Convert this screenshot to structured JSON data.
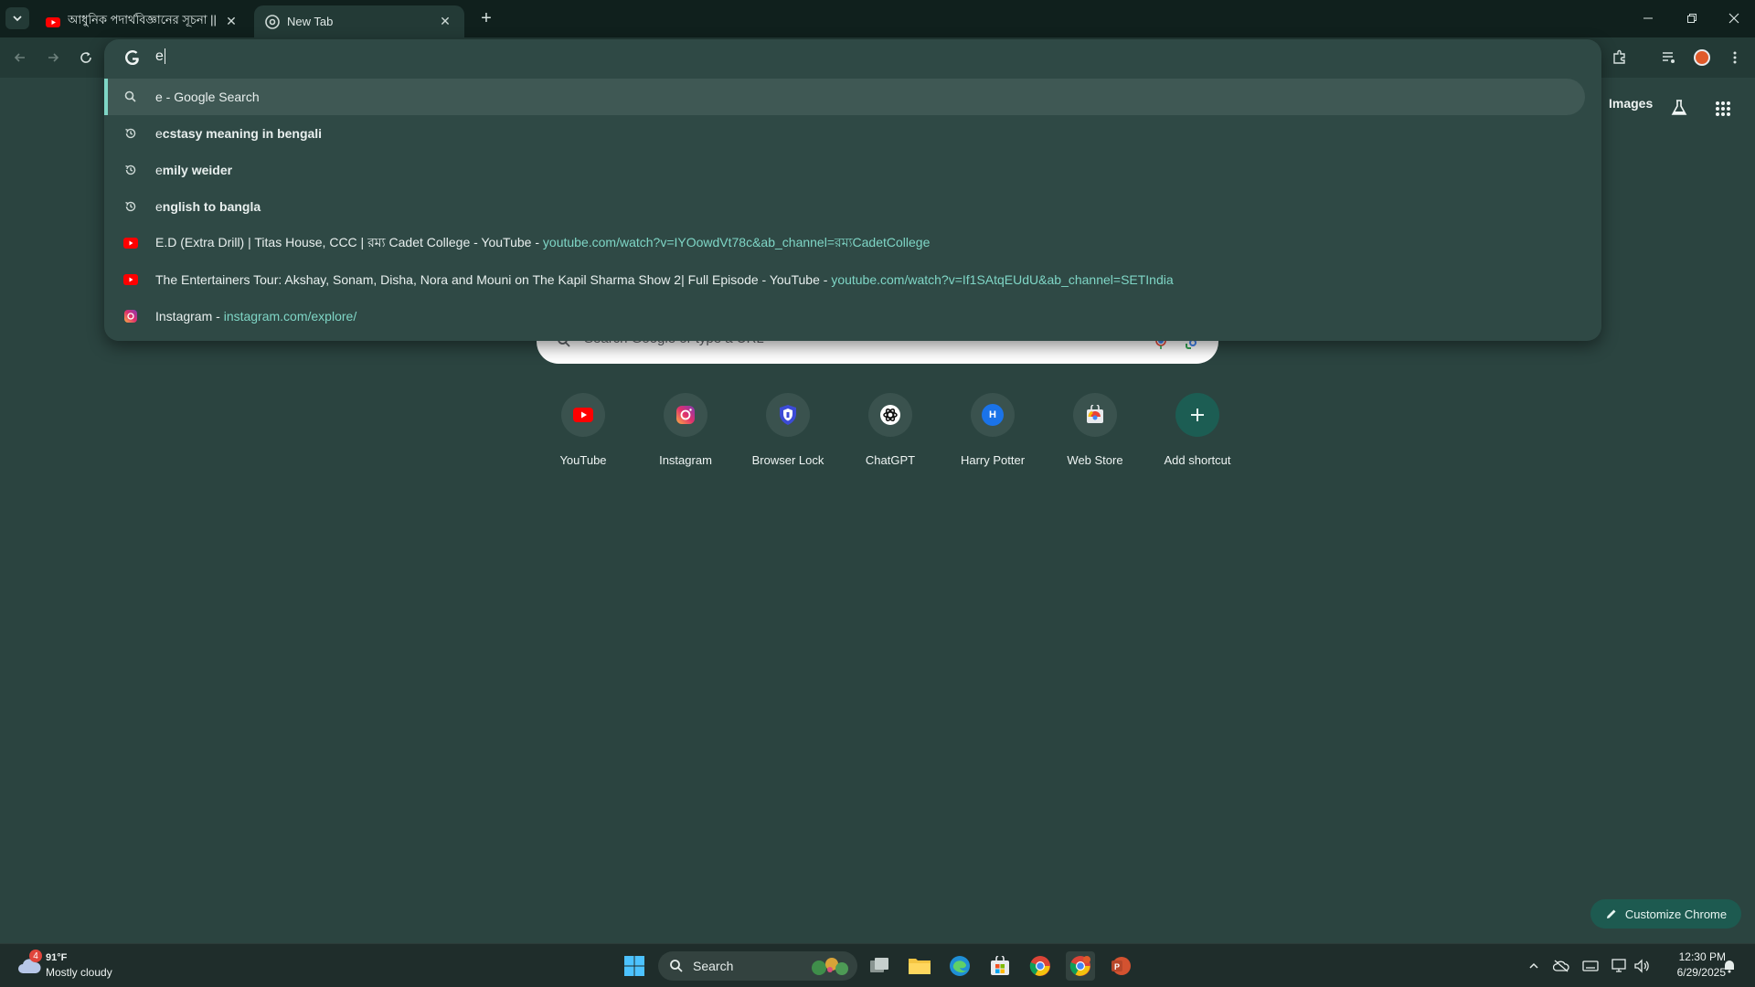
{
  "tabs": [
    {
      "title": "আধুনিক পদার্থবিজ্ঞানের সূচনা ||",
      "favicon": "youtube-icon",
      "active": false
    },
    {
      "title": "New Tab",
      "favicon": "chrome-icon",
      "active": true
    }
  ],
  "omnibox": {
    "typed": "e",
    "suggestions": [
      {
        "type": "search",
        "icon": "search-icon",
        "bold": "",
        "rest": "e - Google Search",
        "url": ""
      },
      {
        "type": "history",
        "icon": "history-icon",
        "prefix": "e",
        "bold": "cstasy meaning in bengali",
        "url": ""
      },
      {
        "type": "history",
        "icon": "history-icon",
        "prefix": "e",
        "bold": "mily weider",
        "url": ""
      },
      {
        "type": "history",
        "icon": "history-icon",
        "prefix": "e",
        "bold": "nglish to bangla",
        "url": ""
      },
      {
        "type": "page",
        "icon": "youtube-icon",
        "text": "E.D (Extra Drill) | Titas House, CCC | রম্য Cadet College - YouTube",
        "url": "youtube.com/watch?v=IYOowdVt78c&ab_channel=রম্যCadetCollege"
      },
      {
        "type": "page",
        "icon": "youtube-icon",
        "text": "The Entertainers Tour: Akshay, Sonam, Disha, Nora and Mouni on The Kapil Sharma Show 2| Full Episode - YouTube",
        "url": "youtube.com/watch?v=If1SAtqEUdU&ab_channel=SETIndia"
      },
      {
        "type": "page",
        "icon": "instagram-icon",
        "text": "Instagram",
        "url": "instagram.com/explore/"
      }
    ]
  },
  "ntp": {
    "images_link": "Images",
    "search_placeholder": "Search Google or type a URL",
    "shortcuts": [
      {
        "label": "YouTube",
        "icon": "youtube-icon"
      },
      {
        "label": "Instagram",
        "icon": "instagram-icon"
      },
      {
        "label": "Browser Lock",
        "icon": "shield-icon"
      },
      {
        "label": "ChatGPT",
        "icon": "chatgpt-icon"
      },
      {
        "label": "Harry Potter",
        "icon": "letter-h-icon",
        "letter": "H"
      },
      {
        "label": "Web Store",
        "icon": "web-store-icon"
      },
      {
        "label": "Add shortcut",
        "icon": "plus-icon"
      }
    ],
    "customize_label": "Customize Chrome"
  },
  "taskbar": {
    "weather_temp": "91°F",
    "weather_desc": "Mostly cloudy",
    "weather_badge": "4",
    "search_label": "Search",
    "time": "12:30 PM",
    "date": "6/29/2025"
  },
  "colors": {
    "accent": "#7fd6c6",
    "background": "#2b4440",
    "youtube": "#ff0000"
  }
}
